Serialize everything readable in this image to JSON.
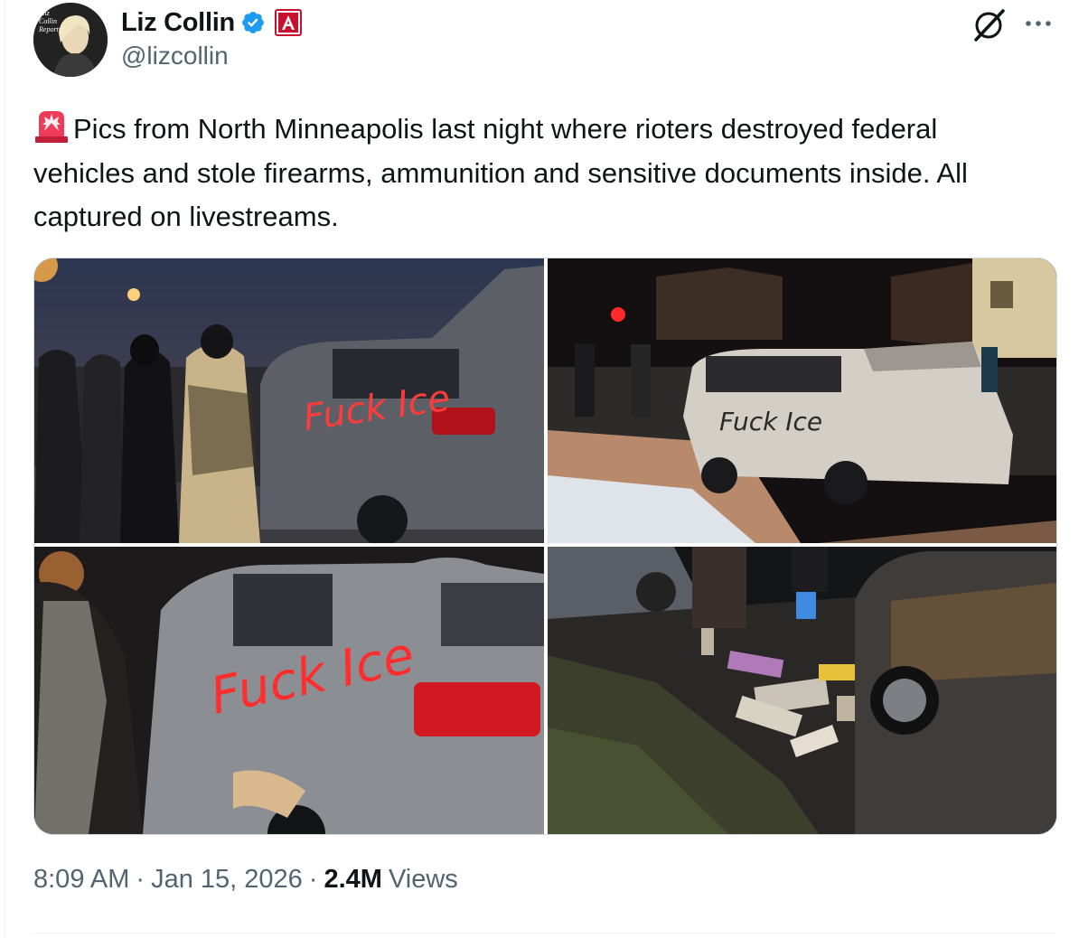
{
  "author": {
    "display_name": "Liz Collin",
    "handle": "@lizcollin",
    "avatar_text": [
      "Liz",
      "Collin",
      "Reports"
    ]
  },
  "icons": {
    "verified": "verified-badge-icon",
    "affiliate": "affiliate-badge-icon",
    "grok": "grok-icon",
    "more": "more-options-icon",
    "siren": "police-siren-emoji-icon"
  },
  "tweet": {
    "text": "Pics from North Minneapolis last night where rioters destroyed federal vehicles and stole firearms, ammunition and sensitive documents inside. All captured on livestreams."
  },
  "media": {
    "photos": [
      {
        "label": "Photo 1: rioters beside vandalized SUV with open rear hatch",
        "graffiti": "Fuck Ice"
      },
      {
        "label": "Photo 2: white SUV with open hood on snowy corner at night",
        "graffiti": "Fuck Ice"
      },
      {
        "label": "Photo 3: close-up of gray SUV covered in red graffiti",
        "graffiti": "Fuck Ice"
      },
      {
        "label": "Photo 4: scattered items and papers on street beside car",
        "graffiti": ""
      }
    ]
  },
  "meta": {
    "time": "8:09 AM",
    "separator": "·",
    "date": "Jan 15, 2026",
    "views_count": "2.4M",
    "views_label": "Views"
  },
  "colors": {
    "text_primary": "#0f1419",
    "text_secondary": "#536471",
    "verified_blue": "#1d9bf0",
    "border": "#cfd9de",
    "graffiti_red": "#ff2d2d"
  }
}
